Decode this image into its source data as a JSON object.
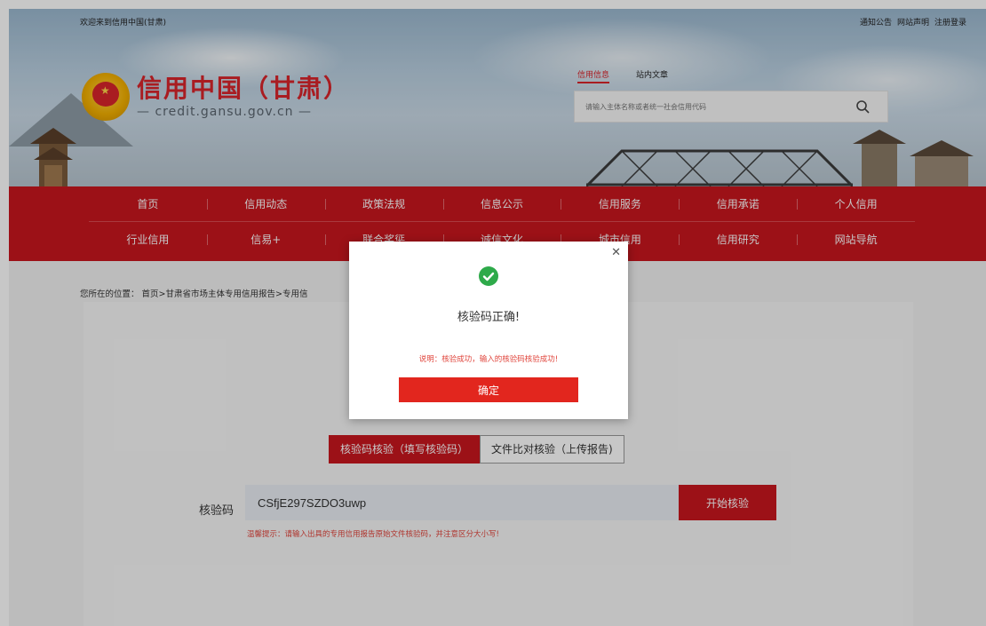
{
  "topbar": {
    "welcome": "欢迎来到信用中国(甘肃)",
    "links": [
      "通知公告",
      "网站声明",
      "注册登录"
    ]
  },
  "logo": {
    "title": "信用中国（甘肃）",
    "subtitle": "— credit.gansu.gov.cn —"
  },
  "search": {
    "tabs": [
      "信用信息",
      "站内文章"
    ],
    "active_tab": 0,
    "placeholder": "请输入主体名称或者统一社会信用代码"
  },
  "nav": {
    "row1": [
      "首页",
      "信用动态",
      "政策法规",
      "信息公示",
      "信用服务",
      "信用承诺",
      "个人信用"
    ],
    "row2": [
      "行业信用",
      "信易+",
      "联合奖惩",
      "诚信文化",
      "城市信用",
      "信用研究",
      "网站导航"
    ]
  },
  "breadcrumb": "您所在的位置：  首页>甘肃省市场主体专用信用报告>专用信",
  "verify": {
    "tab_active": "核验码核验（填写核验码）",
    "tab_inactive": "文件比对核验（上传报告)",
    "code_label": "核验码",
    "code_value": "CSfjE297SZDO3uwp",
    "start_button": "开始核验",
    "tip": "温馨提示：请输入出具的专用信用报告原始文件核验码，并注意区分大小写!"
  },
  "modal": {
    "title": "核验码正确!",
    "note": "说明：核验成功，输入的核验码核验成功!",
    "confirm": "确定"
  },
  "colors": {
    "brand_red": "#c8161e",
    "button_red": "#e2261e",
    "success_green": "#2eaa4a",
    "tip_red": "#e0453c"
  }
}
